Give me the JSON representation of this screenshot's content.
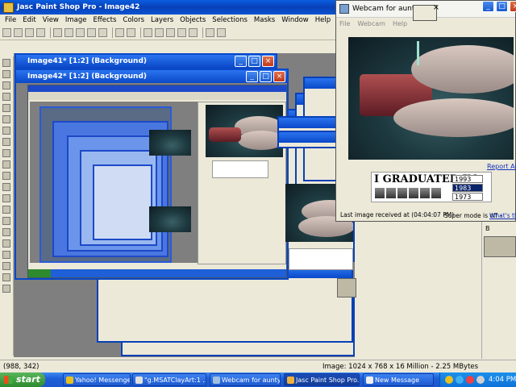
{
  "app": {
    "title": "Jasc Paint Shop Pro - Image42",
    "menu": [
      "File",
      "Edit",
      "View",
      "Image",
      "Effects",
      "Colors",
      "Layers",
      "Objects",
      "Selections",
      "Masks",
      "Window",
      "Help"
    ]
  },
  "documents": [
    {
      "title": "Image41* [1:2] (Background)"
    },
    {
      "title": "Image42* [1:2] (Background)"
    }
  ],
  "webcam": {
    "title": "Webcam for aunty...",
    "menu": [
      "File",
      "Webcam",
      "Help"
    ],
    "report_link": "Report Abuse",
    "last_image": "Last image received at (04:04:07 PM)",
    "super_mode": "Super mode is off - ",
    "whats_this": "What's this?"
  },
  "graduated": {
    "heading": "I GRADUATED IN:",
    "years": [
      "1993",
      "1983",
      "1973"
    ],
    "selected": "1983"
  },
  "side_panel": {
    "label": "B"
  },
  "status": {
    "coords": "(988, 342)",
    "image_info": "Image:  1024 x 768 x 16 Million - 2.25 MBytes"
  },
  "taskbar": {
    "start": "start",
    "tasks": [
      {
        "label": "Yahoo! Messenger ..."
      },
      {
        "label": "\"g.MSATClayArt:1 ..."
      },
      {
        "label": "Webcam for aunty..."
      },
      {
        "label": "Jasc Paint Shop Pro..."
      },
      {
        "label": "New Message"
      }
    ],
    "clock": "4:04 PM"
  },
  "colors": {
    "titlebar_blue": "#0a54d4",
    "workspace_gray": "#7f7f7f",
    "taskbar_blue": "#1f5fd8",
    "start_green": "#2e8a2e"
  }
}
